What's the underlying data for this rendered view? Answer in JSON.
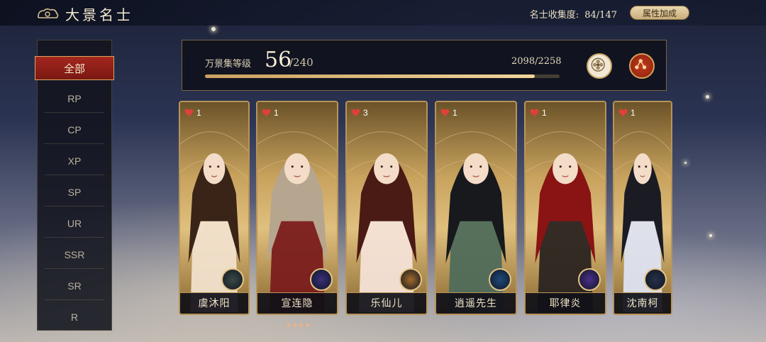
{
  "header": {
    "title": "大景名士",
    "collection_label": "名士收集度:",
    "collection_value": "84/147",
    "attr_button": "属性加成"
  },
  "sidebar": {
    "items": [
      {
        "label": "全部",
        "active": true
      },
      {
        "label": "RP"
      },
      {
        "label": "CP"
      },
      {
        "label": "XP"
      },
      {
        "label": "SP"
      },
      {
        "label": "UR"
      },
      {
        "label": "SSR"
      },
      {
        "label": "SR"
      },
      {
        "label": "R"
      }
    ]
  },
  "level": {
    "label": "万景集等级",
    "value": "56",
    "max": "/240",
    "exp_text": "2098/2258",
    "exp_progress": 0.929
  },
  "cards": [
    {
      "name": "虞沐阳",
      "favor": "1",
      "emblem_color": "#3a4a44",
      "hair": "#3a2418",
      "robe": "#f1e0cc"
    },
    {
      "name": "宣连隐",
      "favor": "1",
      "emblem_color": "#3a2f7a",
      "hair": "#b6a690",
      "robe": "#7a1c1c"
    },
    {
      "name": "乐仙儿",
      "favor": "3",
      "emblem_color": "#a36a2a",
      "hair": "#4a1a14",
      "robe": "#f4e2d6"
    },
    {
      "name": "逍遥先生",
      "favor": "1",
      "emblem_color": "#1f4a7a",
      "hair": "#17191c",
      "robe": "#4f6b5a"
    },
    {
      "name": "耶律炎",
      "favor": "1",
      "emblem_color": "#4b2f8a",
      "hair": "#8a1414",
      "robe": "#2a2420"
    },
    {
      "name": "沈南柯",
      "favor": "1",
      "emblem_color": "#263048",
      "hair": "#1b1b24",
      "robe": "#dde3f0"
    }
  ],
  "colors": {
    "accent_red": "#a4261f",
    "gold": "#c9a060",
    "heart": "#e0403a"
  }
}
